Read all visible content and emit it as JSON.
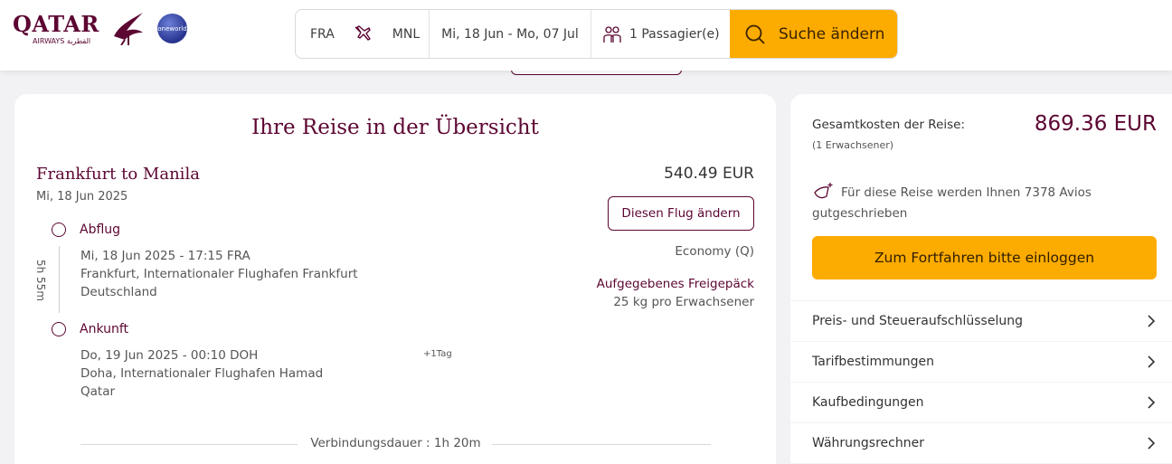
{
  "header": {
    "logo_word": "QATAR",
    "logo_sub": "AIRWAYS القطرية",
    "alliance": "oneworld",
    "search": {
      "origin": "FRA",
      "destination": "MNL",
      "dates": "Mi, 18 Jun - Mo, 07 Jul",
      "passengers": "1 Passagier(e)",
      "button": "Suche ändern"
    }
  },
  "overview": {
    "title": "Ihre Reise in der Übersicht",
    "route_title": "Frankfurt to Manila",
    "route_date": "Mi, 18 Jun 2025",
    "price": "540.49 EUR",
    "change_button": "Diesen Flug ändern",
    "cabin": "Economy (Q)",
    "baggage_label": "Aufgegebenes Freigepäck",
    "baggage_value": "25 kg pro Erwachsener",
    "duration": "5h 55m",
    "departure": {
      "label": "Abflug",
      "datetime": "Mi, 18 Jun 2025 - 17:15 FRA",
      "airport": "Frankfurt, Internationaler Flughafen Frankfurt",
      "country": "Deutschland"
    },
    "arrival": {
      "label": "Ankunft",
      "datetime": "Do, 19 Jun 2025 - 00:10 DOH",
      "next_day": "+1Tag",
      "airport": "Doha, Internationaler Flughafen Hamad",
      "country": "Qatar"
    },
    "connection": "Verbindungsdauer : 1h 20m"
  },
  "summary": {
    "total_label": "Gesamtkosten der Reise:",
    "total_sub": "(1 Erwachsener)",
    "total_price": "869.36 EUR",
    "avios_text": "Für diese Reise werden Ihnen 7378 Avios gutgeschrieben",
    "login_button": "Zum Fortfahren bitte einloggen",
    "rows": [
      "Preis- und Steueraufschlüsselung",
      "Tarifbestimmungen",
      "Kaufbedingungen",
      "Währungsrechner"
    ]
  },
  "colors": {
    "brand": "#5c0632",
    "accent": "#fcab00",
    "background": "#f2f2f4"
  }
}
